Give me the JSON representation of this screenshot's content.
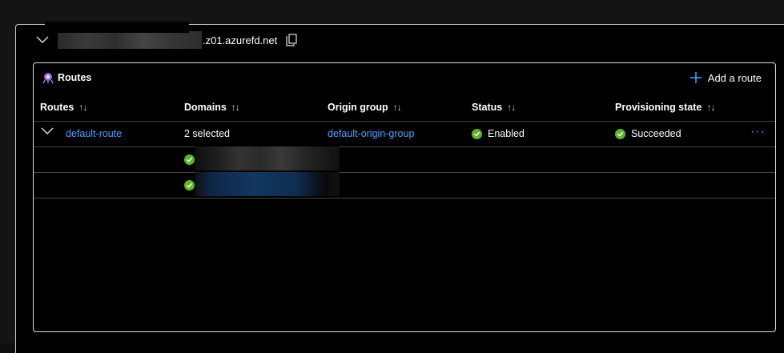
{
  "endpoint": {
    "host_suffix": ".z01.azurefd.net"
  },
  "panel": {
    "title": "Routes",
    "add_label": "Add a route"
  },
  "table": {
    "columns": [
      "Routes",
      "Domains",
      "Origin group",
      "Status",
      "Provisioning state"
    ],
    "sort_glyph": "↑↓",
    "rows": [
      {
        "route": "default-route",
        "domains": "2 selected",
        "origin_group": "default-origin-group",
        "status": "Enabled",
        "provisioning": "Succeeded",
        "more": "···"
      }
    ]
  },
  "colors": {
    "link": "#4aa3ff",
    "success": "#5fb52a",
    "accent": "#4aa3ff"
  },
  "icons": [
    "chevron-down-icon",
    "copy-icon",
    "routes-icon",
    "plus-icon",
    "sort-icon",
    "check-circle-icon",
    "more-icon"
  ]
}
